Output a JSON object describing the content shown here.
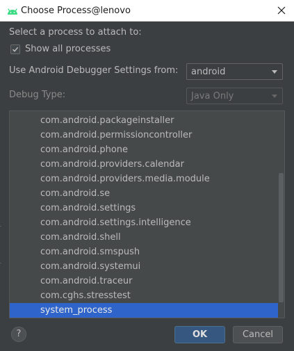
{
  "window": {
    "title": "Choose Process@lenovo"
  },
  "prompt": {
    "label": "Select a process to attach to:"
  },
  "show_all": {
    "label": "Show all processes",
    "checked": true
  },
  "debugger_settings": {
    "label": "Use Android Debugger Settings from:",
    "value": "android"
  },
  "debug_type": {
    "label": "Debug Type:",
    "value": "Java Only",
    "disabled": true
  },
  "processes": [
    "com.android.packageinstaller",
    "com.android.permissioncontroller",
    "com.android.phone",
    "com.android.providers.calendar",
    "com.android.providers.media.module",
    "com.android.se",
    "com.android.settings",
    "com.android.settings.intelligence",
    "com.android.shell",
    "com.android.smspush",
    "com.android.systemui",
    "com.android.traceur",
    "com.cghs.stresstest",
    "system_process"
  ],
  "selected_process": "system_process",
  "buttons": {
    "help": "?",
    "ok": "OK",
    "cancel": "Cancel"
  },
  "colors": {
    "background": "#3c3f41",
    "list_background": "#45494a",
    "selection": "#2f65ca",
    "ok_button": "#365880",
    "android_icon": "#3ddc84"
  },
  "icons": {
    "title": "android-icon",
    "close": "close-icon",
    "checkbox": "checkmark-icon",
    "combo_arrow": "chevron-down-icon"
  }
}
